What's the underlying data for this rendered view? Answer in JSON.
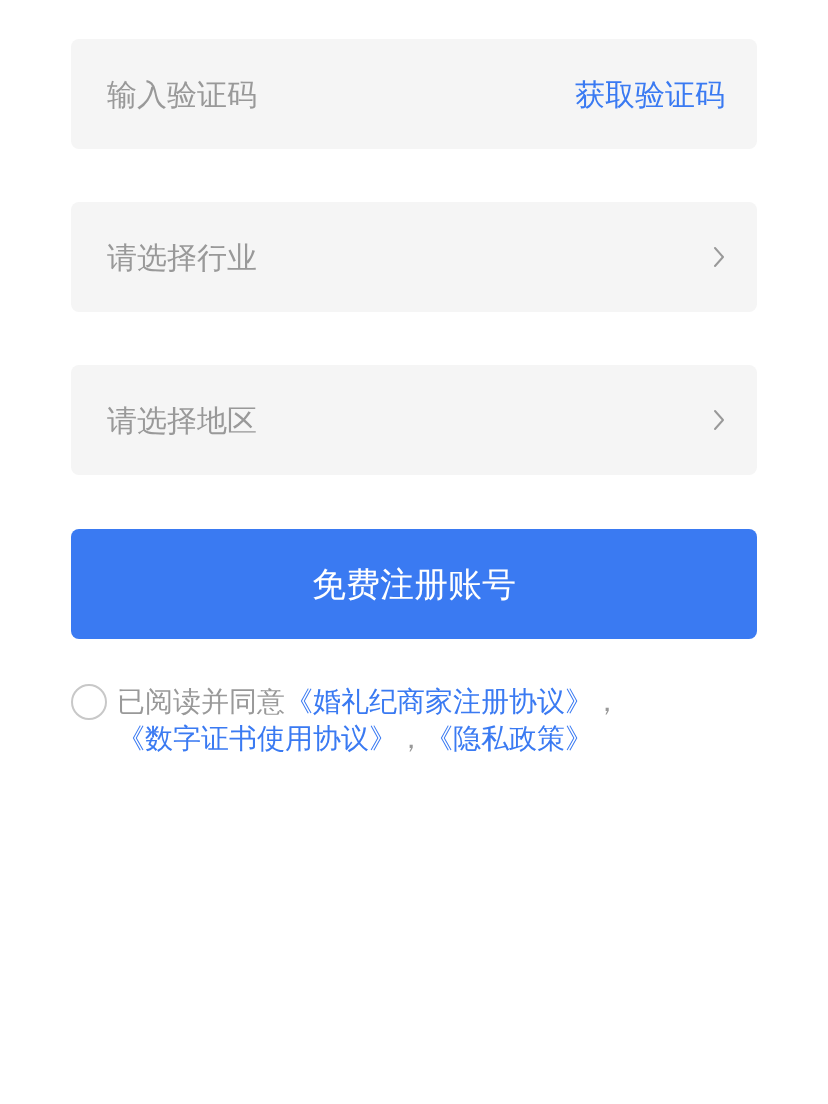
{
  "fields": [
    {
      "kind": "code",
      "placeholder": "输入验证码",
      "action": "获取验证码"
    },
    {
      "kind": "select",
      "placeholder": "请选择行业"
    },
    {
      "kind": "select",
      "placeholder": "请选择地区"
    }
  ],
  "submit": "免费注册账号",
  "agreement": {
    "checked": false,
    "parts": [
      {
        "kind": "text",
        "text": "已阅读并同意"
      },
      {
        "kind": "link",
        "text": "《婚礼纪商家注册协议》"
      },
      {
        "kind": "text",
        "text": "，"
      },
      {
        "kind": "link",
        "text": "《数字证书使用协议》"
      },
      {
        "kind": "text",
        "text": "，"
      },
      {
        "kind": "link",
        "text": "《隐私政策》"
      }
    ]
  }
}
